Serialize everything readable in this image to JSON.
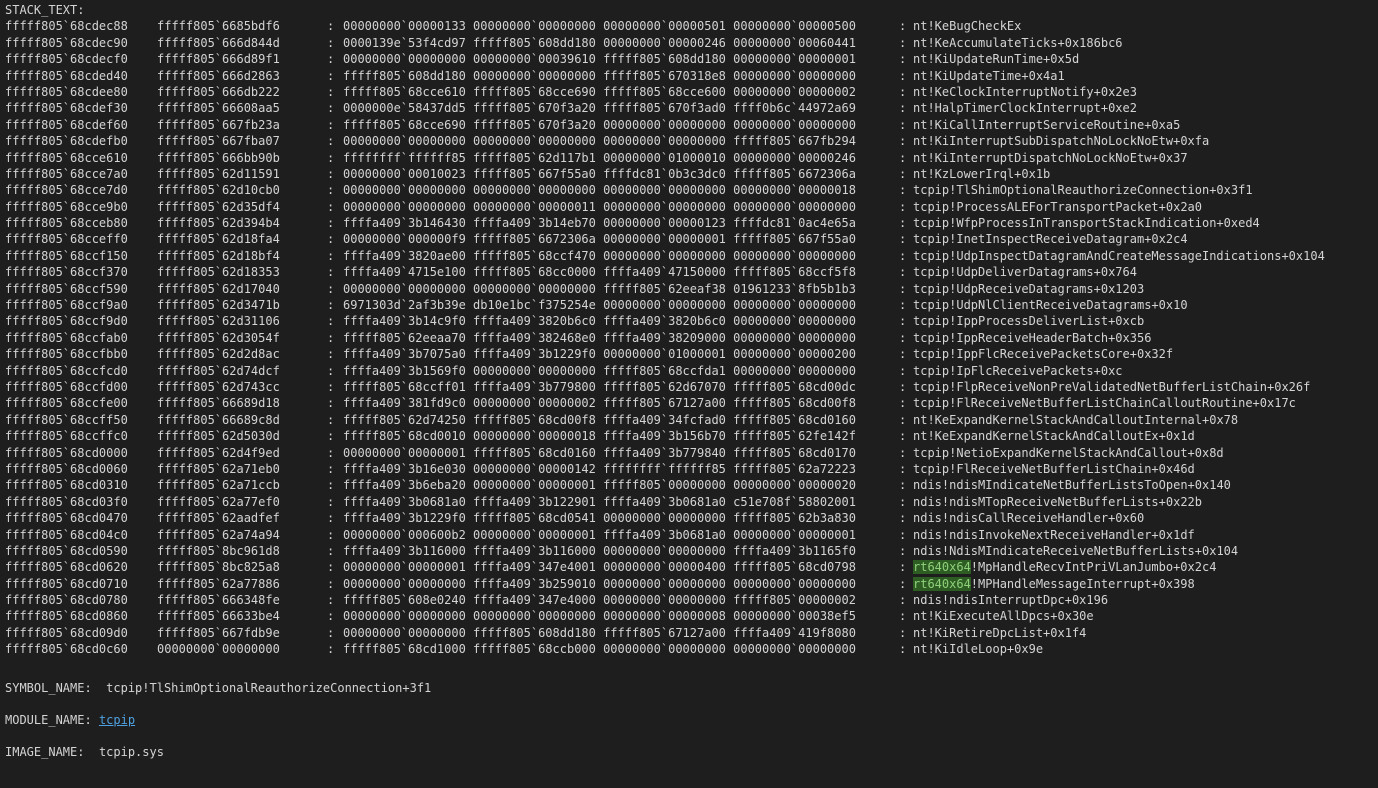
{
  "header": "STACK_TEXT:",
  "frames": [
    {
      "child_sp": "fffff805`68cdec88",
      "ret_addr": "fffff805`6685bdf6",
      "args": "00000000`00000133 00000000`00000000 00000000`00000501 00000000`00000500",
      "module": "nt",
      "call": "!KeBugCheckEx"
    },
    {
      "child_sp": "fffff805`68cdec90",
      "ret_addr": "fffff805`666d844d",
      "args": "0000139e`53f4cd97 fffff805`608dd180 00000000`00000246 00000000`00060441",
      "module": "nt",
      "call": "!KeAccumulateTicks+0x186bc6"
    },
    {
      "child_sp": "fffff805`68cdecf0",
      "ret_addr": "fffff805`666d89f1",
      "args": "00000000`00000000 00000000`00039610 fffff805`608dd180 00000000`00000001",
      "module": "nt",
      "call": "!KiUpdateRunTime+0x5d"
    },
    {
      "child_sp": "fffff805`68cded40",
      "ret_addr": "fffff805`666d2863",
      "args": "fffff805`608dd180 00000000`00000000 fffff805`670318e8 00000000`00000000",
      "module": "nt",
      "call": "!KiUpdateTime+0x4a1"
    },
    {
      "child_sp": "fffff805`68cdee80",
      "ret_addr": "fffff805`666db222",
      "args": "fffff805`68cce610 fffff805`68cce690 fffff805`68cce600 00000000`00000002",
      "module": "nt",
      "call": "!KeClockInterruptNotify+0x2e3"
    },
    {
      "child_sp": "fffff805`68cdef30",
      "ret_addr": "fffff805`66608aa5",
      "args": "0000000e`58437dd5 fffff805`670f3a20 fffff805`670f3ad0 ffff0b6c`44972a69",
      "module": "nt",
      "call": "!HalpTimerClockInterrupt+0xe2"
    },
    {
      "child_sp": "fffff805`68cdef60",
      "ret_addr": "fffff805`667fb23a",
      "args": "fffff805`68cce690 fffff805`670f3a20 00000000`00000000 00000000`00000000",
      "module": "nt",
      "call": "!KiCallInterruptServiceRoutine+0xa5"
    },
    {
      "child_sp": "fffff805`68cdefb0",
      "ret_addr": "fffff805`667fba07",
      "args": "00000000`00000000 00000000`00000000 00000000`00000000 fffff805`667fb294",
      "module": "nt",
      "call": "!KiInterruptSubDispatchNoLockNoEtw+0xfa"
    },
    {
      "child_sp": "fffff805`68cce610",
      "ret_addr": "fffff805`666bb90b",
      "args": "ffffffff`ffffff85 fffff805`62d117b1 00000000`01000010 00000000`00000246",
      "module": "nt",
      "call": "!KiInterruptDispatchNoLockNoEtw+0x37"
    },
    {
      "child_sp": "fffff805`68cce7a0",
      "ret_addr": "fffff805`62d11591",
      "args": "00000000`00010023 fffff805`667f55a0 ffffdc81`0b3c3dc0 fffff805`6672306a",
      "module": "nt",
      "call": "!KzLowerIrql+0x1b"
    },
    {
      "child_sp": "fffff805`68cce7d0",
      "ret_addr": "fffff805`62d10cb0",
      "args": "00000000`00000000 00000000`00000000 00000000`00000000 00000000`00000018",
      "module": "tcpip",
      "call": "!TlShimOptionalReauthorizeConnection+0x3f1"
    },
    {
      "child_sp": "fffff805`68cce9b0",
      "ret_addr": "fffff805`62d35df4",
      "args": "00000000`00000000 00000000`00000011 00000000`00000000 00000000`00000000",
      "module": "tcpip",
      "call": "!ProcessALEForTransportPacket+0x2a0"
    },
    {
      "child_sp": "fffff805`68cceb80",
      "ret_addr": "fffff805`62d394b4",
      "args": "ffffa409`3b146430 ffffa409`3b14eb70 00000000`00000123 ffffdc81`0ac4e65a",
      "module": "tcpip",
      "call": "!WfpProcessInTransportStackIndication+0xed4"
    },
    {
      "child_sp": "fffff805`68cceff0",
      "ret_addr": "fffff805`62d18fa4",
      "args": "00000000`000000f9 fffff805`6672306a 00000000`00000001 fffff805`667f55a0",
      "module": "tcpip",
      "call": "!InetInspectReceiveDatagram+0x2c4"
    },
    {
      "child_sp": "fffff805`68ccf150",
      "ret_addr": "fffff805`62d18bf4",
      "args": "ffffa409`3820ae00 fffff805`68ccf470 00000000`00000000 00000000`00000000",
      "module": "tcpip",
      "call": "!UdpInspectDatagramAndCreateMessageIndications+0x104"
    },
    {
      "child_sp": "fffff805`68ccf370",
      "ret_addr": "fffff805`62d18353",
      "args": "ffffa409`4715e100 fffff805`68cc0000 ffffa409`47150000 fffff805`68ccf5f8",
      "module": "tcpip",
      "call": "!UdpDeliverDatagrams+0x764"
    },
    {
      "child_sp": "fffff805`68ccf590",
      "ret_addr": "fffff805`62d17040",
      "args": "00000000`00000000 00000000`00000000 fffff805`62eeaf38 01961233`8fb5b1b3",
      "module": "tcpip",
      "call": "!UdpReceiveDatagrams+0x1203"
    },
    {
      "child_sp": "fffff805`68ccf9a0",
      "ret_addr": "fffff805`62d3471b",
      "args": "6971303d`2af3b39e db10e1bc`f375254e 00000000`00000000 00000000`00000000",
      "module": "tcpip",
      "call": "!UdpNlClientReceiveDatagrams+0x10"
    },
    {
      "child_sp": "fffff805`68ccf9d0",
      "ret_addr": "fffff805`62d31106",
      "args": "ffffa409`3b14c9f0 ffffa409`3820b6c0 ffffa409`3820b6c0 00000000`00000000",
      "module": "tcpip",
      "call": "!IppProcessDeliverList+0xcb"
    },
    {
      "child_sp": "fffff805`68ccfab0",
      "ret_addr": "fffff805`62d3054f",
      "args": "fffff805`62eeaa70 ffffa409`382468e0 ffffa409`38209000 00000000`00000000",
      "module": "tcpip",
      "call": "!IppReceiveHeaderBatch+0x356"
    },
    {
      "child_sp": "fffff805`68ccfbb0",
      "ret_addr": "fffff805`62d2d8ac",
      "args": "ffffa409`3b7075a0 ffffa409`3b1229f0 00000000`01000001 00000000`00000200",
      "module": "tcpip",
      "call": "!IppFlcReceivePacketsCore+0x32f"
    },
    {
      "child_sp": "fffff805`68ccfcd0",
      "ret_addr": "fffff805`62d74dcf",
      "args": "ffffa409`3b1569f0 00000000`00000000 fffff805`68ccfda1 00000000`00000000",
      "module": "tcpip",
      "call": "!IpFlcReceivePackets+0xc"
    },
    {
      "child_sp": "fffff805`68ccfd00",
      "ret_addr": "fffff805`62d743cc",
      "args": "fffff805`68ccff01 ffffa409`3b779800 fffff805`62d67070 fffff805`68cd00dc",
      "module": "tcpip",
      "call": "!FlpReceiveNonPreValidatedNetBufferListChain+0x26f"
    },
    {
      "child_sp": "fffff805`68ccfe00",
      "ret_addr": "fffff805`66689d18",
      "args": "ffffa409`381fd9c0 00000000`00000002 fffff805`67127a00 fffff805`68cd00f8",
      "module": "tcpip",
      "call": "!FlReceiveNetBufferListChainCalloutRoutine+0x17c"
    },
    {
      "child_sp": "fffff805`68ccff50",
      "ret_addr": "fffff805`66689c8d",
      "args": "fffff805`62d74250 fffff805`68cd00f8 ffffa409`34fcfad0 fffff805`68cd0160",
      "module": "nt",
      "call": "!KeExpandKernelStackAndCalloutInternal+0x78"
    },
    {
      "child_sp": "fffff805`68ccffc0",
      "ret_addr": "fffff805`62d5030d",
      "args": "fffff805`68cd0010 00000000`00000018 ffffa409`3b156b70 fffff805`62fe142f",
      "module": "nt",
      "call": "!KeExpandKernelStackAndCalloutEx+0x1d"
    },
    {
      "child_sp": "fffff805`68cd0000",
      "ret_addr": "fffff805`62d4f9ed",
      "args": "00000000`00000001 fffff805`68cd0160 ffffa409`3b779840 fffff805`68cd0170",
      "module": "tcpip",
      "call": "!NetioExpandKernelStackAndCallout+0x8d"
    },
    {
      "child_sp": "fffff805`68cd0060",
      "ret_addr": "fffff805`62a71eb0",
      "args": "ffffa409`3b16e030 00000000`00000142 ffffffff`ffffff85 fffff805`62a72223",
      "module": "tcpip",
      "call": "!FlReceiveNetBufferListChain+0x46d"
    },
    {
      "child_sp": "fffff805`68cd0310",
      "ret_addr": "fffff805`62a71ccb",
      "args": "ffffa409`3b6eba20 00000000`00000001 fffff805`00000000 00000000`00000020",
      "module": "ndis",
      "call": "!ndisMIndicateNetBufferListsToOpen+0x140"
    },
    {
      "child_sp": "fffff805`68cd03f0",
      "ret_addr": "fffff805`62a77ef0",
      "args": "ffffa409`3b0681a0 ffffa409`3b122901 ffffa409`3b0681a0 c51e708f`58802001",
      "module": "ndis",
      "call": "!ndisMTopReceiveNetBufferLists+0x22b"
    },
    {
      "child_sp": "fffff805`68cd0470",
      "ret_addr": "fffff805`62aadfef",
      "args": "ffffa409`3b1229f0 fffff805`68cd0541 00000000`00000000 fffff805`62b3a830",
      "module": "ndis",
      "call": "!ndisCallReceiveHandler+0x60"
    },
    {
      "child_sp": "fffff805`68cd04c0",
      "ret_addr": "fffff805`62a74a94",
      "args": "00000000`000600b2 00000000`00000001 ffffa409`3b0681a0 00000000`00000001",
      "module": "ndis",
      "call": "!ndisInvokeNextReceiveHandler+0x1df"
    },
    {
      "child_sp": "fffff805`68cd0590",
      "ret_addr": "fffff805`8bc961d8",
      "args": "ffffa409`3b116000 ffffa409`3b116000 00000000`00000000 ffffa409`3b1165f0",
      "module": "ndis",
      "call": "!NdisMIndicateReceiveNetBufferLists+0x104"
    },
    {
      "child_sp": "fffff805`68cd0620",
      "ret_addr": "fffff805`8bc825a8",
      "args": "00000000`00000001 ffffa409`347e4001 00000000`00000400 fffff805`68cd0798",
      "module": "rt640x64",
      "call": "!MpHandleRecvIntPriVLanJumbo+0x2c4",
      "highlight": true
    },
    {
      "child_sp": "fffff805`68cd0710",
      "ret_addr": "fffff805`62a77886",
      "args": "00000000`00000000 ffffa409`3b259010 00000000`00000000 00000000`00000000",
      "module": "rt640x64",
      "call": "!MPHandleMessageInterrupt+0x398",
      "highlight": true
    },
    {
      "child_sp": "fffff805`68cd0780",
      "ret_addr": "fffff805`666348fe",
      "args": "fffff805`608e0240 ffffa409`347e4000 00000000`00000000 fffff805`00000002",
      "module": "ndis",
      "call": "!ndisInterruptDpc+0x196"
    },
    {
      "child_sp": "fffff805`68cd0860",
      "ret_addr": "fffff805`66633be4",
      "args": "00000000`00000000 00000000`00000000 00000000`00000008 00000000`00038ef5",
      "module": "nt",
      "call": "!KiExecuteAllDpcs+0x30e"
    },
    {
      "child_sp": "fffff805`68cd09d0",
      "ret_addr": "fffff805`667fdb9e",
      "args": "00000000`00000000 fffff805`608dd180 fffff805`67127a00 ffffa409`419f8080",
      "module": "nt",
      "call": "!KiRetireDpcList+0x1f4"
    },
    {
      "child_sp": "fffff805`68cd0c60",
      "ret_addr": "00000000`00000000",
      "args": "fffff805`68cd1000 fffff805`68ccb000 00000000`00000000 00000000`00000000",
      "module": "nt",
      "call": "!KiIdleLoop+0x9e"
    }
  ],
  "symbol_name": {
    "label": "SYMBOL_NAME:",
    "value": "tcpip!TlShimOptionalReauthorizeConnection+3f1"
  },
  "module_name": {
    "label": "MODULE_NAME:",
    "value": "tcpip"
  },
  "image_name": {
    "label": "IMAGE_NAME:",
    "value": "tcpip.sys"
  },
  "colors": {
    "background": "#1e1e1e",
    "text": "#d4d4d4",
    "highlight_bg": "#2e5d24",
    "highlight_text": "#8fd17a",
    "link": "#4ea1e0"
  }
}
